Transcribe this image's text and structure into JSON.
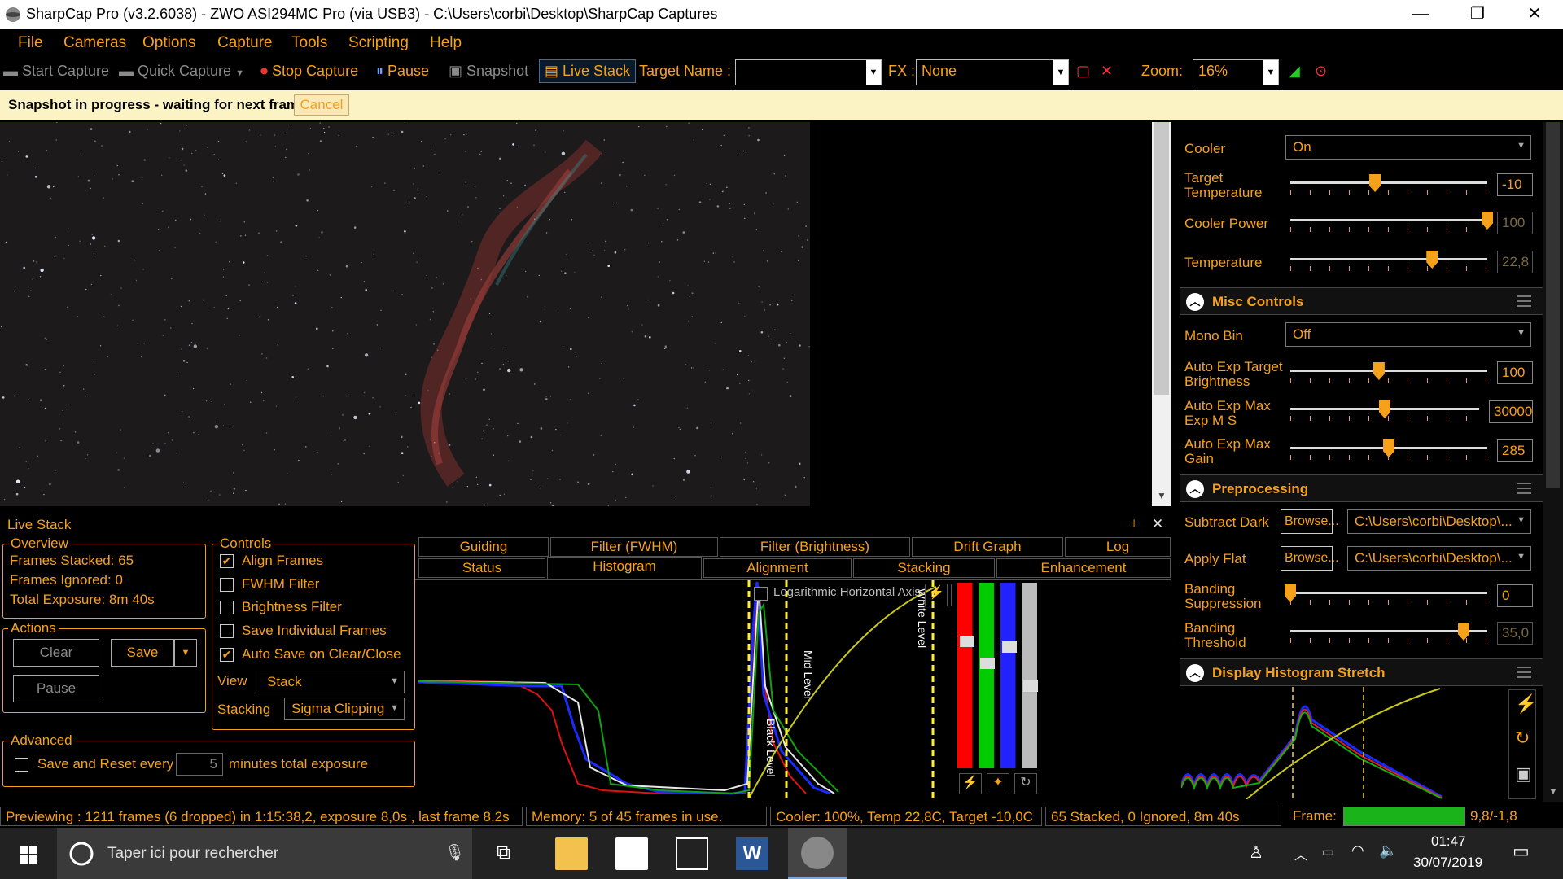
{
  "window": {
    "title": "SharpCap Pro (v3.2.6038) - ZWO ASI294MC Pro (via USB3) - C:\\Users\\corbi\\Desktop\\SharpCap Captures",
    "min": "—",
    "max": "❐",
    "close": "✕"
  },
  "menu": [
    "File",
    "Cameras",
    "Options",
    "Capture",
    "Tools",
    "Scripting",
    "Help"
  ],
  "toolbar": {
    "start_capture": "Start Capture",
    "quick_capture": "Quick Capture",
    "stop_capture": "Stop Capture",
    "pause": "Pause",
    "snapshot": "Snapshot",
    "live_stack": "Live Stack",
    "target_name_label": "Target Name :",
    "target_name_value": "",
    "fx_label": "FX :",
    "fx_value": "None",
    "zoom_label": "Zoom:",
    "zoom_value": "16%"
  },
  "notification": {
    "text": "Snapshot in progress - waiting for next frame.",
    "cancel": "Cancel"
  },
  "right_panel": {
    "cooler_label": "Cooler",
    "cooler_value": "On",
    "target_temp_label1": "Target",
    "target_temp_label2": "Temperature",
    "target_temp_value": "-10",
    "target_temp_level": 0.43,
    "cooler_power_label": "Cooler Power",
    "cooler_power_value": "100",
    "cooler_power_level": 1.0,
    "temperature_label": "Temperature",
    "temperature_value": "22,8",
    "temperature_level": 0.72,
    "misc": {
      "title": "Misc Controls",
      "mono_bin_label": "Mono Bin",
      "mono_bin_value": "Off",
      "aet_label1": "Auto Exp Target",
      "aet_label2": "Brightness",
      "aet_value": "100",
      "aet_level": 0.45,
      "aem_label1": "Auto Exp Max",
      "aem_label2": "Exp M S",
      "aem_value": "30000",
      "aem_level": 0.5,
      "aeg_label1": "Auto Exp Max",
      "aeg_label2": "Gain",
      "aeg_value": "285",
      "aeg_level": 0.5
    },
    "pre": {
      "title": "Preprocessing",
      "subtract_dark_label": "Subtract Dark",
      "browse": "Browse...",
      "dark_path": "C:\\Users\\corbi\\Desktop\\...",
      "apply_flat_label": "Apply Flat",
      "flat_path": "C:\\Users\\corbi\\Desktop\\...",
      "banding_sup_label1": "Banding",
      "banding_sup_label2": "Suppression",
      "banding_sup_value": "0",
      "banding_sup_level": 0.0,
      "banding_thr_label1": "Banding",
      "banding_thr_label2": "Threshold",
      "banding_thr_value": "35,0",
      "banding_thr_level": 0.88
    },
    "dhs": {
      "title": "Display Histogram Stretch"
    }
  },
  "live_stack": {
    "title": "Live Stack",
    "pin": "📌",
    "close": "✕",
    "overview": {
      "title": "Overview",
      "frames_stacked": "Frames Stacked:  65",
      "frames_ignored": "Frames Ignored:  0",
      "total_exposure": "Total Exposure:   8m 40s"
    },
    "actions": {
      "title": "Actions",
      "clear": "Clear",
      "save": "Save",
      "pause": "Pause"
    },
    "controls": {
      "title": "Controls",
      "align": "Align Frames",
      "fwhm": "FWHM Filter",
      "bright": "Brightness Filter",
      "save_ind": "Save Individual Frames",
      "auto_save": "Auto Save on Clear/Close",
      "view_label": "View",
      "view_value": "Stack",
      "stacking_label": "Stacking",
      "stacking_value": "Sigma Clipping"
    },
    "advanced": {
      "title": "Advanced",
      "save_reset": "Save and Reset every",
      "minutes_value": "5",
      "minutes_label": "minutes total exposure"
    },
    "tabs_row1": [
      "Guiding",
      "Filter (FWHM)",
      "Filter (Brightness)",
      "Drift Graph",
      "Log"
    ],
    "tabs_row2": [
      "Status",
      "Histogram",
      "Alignment",
      "Stacking",
      "Enhancement"
    ],
    "histogram": {
      "log_axis": "Logarithmic Horizontal Axis",
      "black_level": "Black Level",
      "mid_level": "Mid Level",
      "white_level": "White Level"
    }
  },
  "status": {
    "preview": "Previewing : 1211 frames (6 dropped) in 1:15:38,2, exposure 8,0s , last frame 8,2s",
    "memory": "Memory: 5 of 45 frames in use.",
    "cooler": "Cooler: 100%, Temp 22,8C, Target -10,0C",
    "stacked": "65 Stacked, 0 Ignored, 8m 40s",
    "frame_label": "Frame:",
    "frame_value": "9,8/-1,8",
    "frame_progress": 1.0
  },
  "taskbar": {
    "search": "Taper ici pour rechercher",
    "time": "01:47",
    "date": "30/07/2019"
  },
  "colors": {
    "accent": "#f6a11a",
    "notif_bg": "#fbf3c4",
    "frame_bar": "#1ab31a"
  }
}
